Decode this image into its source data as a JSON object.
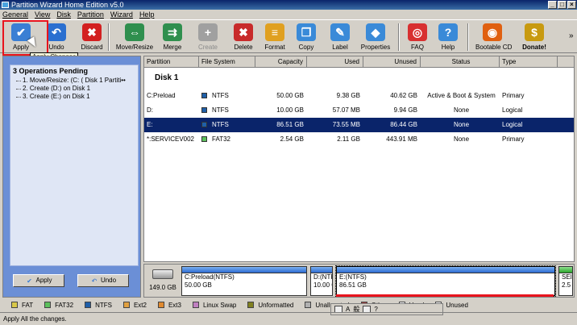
{
  "window": {
    "title": "Partition Wizard Home Edition v5.0"
  },
  "menu": [
    "General",
    "View",
    "Disk",
    "Partition",
    "Wizard",
    "Help"
  ],
  "toolbar": [
    {
      "label": "Apply",
      "icon": "checkmark-icon",
      "color": "#3a7fd4",
      "disabled": false
    },
    {
      "label": "Undo",
      "icon": "undo-arrow-icon",
      "color": "#2a6fd0",
      "disabled": false
    },
    {
      "label": "Discard",
      "icon": "red-x-icon",
      "color": "#d32020",
      "disabled": false
    },
    {
      "label": "Move/Resize",
      "icon": "move-resize-icon",
      "color": "#2f8f4e",
      "disabled": false
    },
    {
      "label": "Merge",
      "icon": "merge-icon",
      "color": "#2f8f4e",
      "disabled": false
    },
    {
      "label": "Create",
      "icon": "create-plus-icon",
      "color": "#a0a0a0",
      "disabled": true
    },
    {
      "label": "Delete",
      "icon": "delete-icon",
      "color": "#c82a2a",
      "disabled": false
    },
    {
      "label": "Format",
      "icon": "format-icon",
      "color": "#e0a020",
      "disabled": false
    },
    {
      "label": "Copy",
      "icon": "copy-icon",
      "color": "#3a8ad8",
      "disabled": false
    },
    {
      "label": "Label",
      "icon": "label-icon",
      "color": "#3a8ad8",
      "disabled": false
    },
    {
      "label": "Properties",
      "icon": "properties-icon",
      "color": "#3a8ad8",
      "disabled": false
    },
    {
      "label": "FAQ",
      "icon": "lifebuoy-icon",
      "color": "#d83030",
      "disabled": false
    },
    {
      "label": "Help",
      "icon": "help-icon",
      "color": "#3a8ad8",
      "disabled": false
    },
    {
      "label": "Bootable CD",
      "icon": "bootable-cd-icon",
      "color": "#e06010",
      "disabled": false
    },
    {
      "label": "Donate!",
      "icon": "dollar-icon",
      "color": "#c89a10",
      "disabled": false
    }
  ],
  "tooltip": "Apply Changes",
  "pending": {
    "title": "3 Operations Pending",
    "items": [
      "1. Move/Resize: (C: ( Disk 1 Partiti••",
      "2. Create (D:) on Disk 1",
      "3. Create (E:) on Disk 1"
    ]
  },
  "left_buttons": {
    "apply": "Apply",
    "undo": "Undo"
  },
  "table": {
    "headers": [
      "Partition",
      "File System",
      "Capacity",
      "Used",
      "Unused",
      "Status",
      "Type"
    ],
    "disk_label": "Disk 1",
    "rows": [
      {
        "partition": "C:Preload",
        "fs": "NTFS",
        "fs_color": "#1f5fa8",
        "capacity": "50.00 GB",
        "used": "9.38 GB",
        "unused": "40.62 GB",
        "status": "Active & Boot & System",
        "type": "Primary"
      },
      {
        "partition": "D:",
        "fs": "NTFS",
        "fs_color": "#1f5fa8",
        "capacity": "10.00 GB",
        "used": "57.07 MB",
        "unused": "9.94 GB",
        "status": "None",
        "type": "Logical"
      },
      {
        "partition": "E:",
        "fs": "NTFS",
        "fs_color": "#1f5fa8",
        "capacity": "86.51 GB",
        "used": "73.55 MB",
        "unused": "86.44 GB",
        "status": "None",
        "type": "Logical"
      },
      {
        "partition": "*:SERVICEV002",
        "fs": "FAT32",
        "fs_color": "#5cc05c",
        "capacity": "2.54 GB",
        "used": "2.11 GB",
        "unused": "443.91 MB",
        "status": "None",
        "type": "Primary"
      }
    ]
  },
  "disk_map": {
    "disk_size": "149.0 GB",
    "segments": [
      {
        "line1": "C:Preload(NTFS)",
        "line2": "50.00 GB"
      },
      {
        "line1": "D:(NTFS",
        "line2": "10.00 G"
      },
      {
        "line1": "E:(NTFS)",
        "line2": "86.51 GB"
      },
      {
        "line1": "SEI",
        "line2": "2.5"
      }
    ]
  },
  "legend": [
    {
      "label": "FAT",
      "color": "#d8c84a"
    },
    {
      "label": "FAT32",
      "color": "#5cc05c"
    },
    {
      "label": "NTFS",
      "color": "#1f5fa8"
    },
    {
      "label": "Ext2",
      "color": "#e0a040"
    },
    {
      "label": "Ext3",
      "color": "#e08a30"
    },
    {
      "label": "Linux Swap",
      "color": "#c080c0"
    },
    {
      "label": "Unformatted",
      "color": "#808020"
    },
    {
      "label": "Unallocated",
      "color": "#b0b0b0"
    },
    {
      "label": "Other",
      "color": "#a04040"
    },
    {
      "label": "Used",
      "color": "#ffffff"
    },
    {
      "label": "Unused",
      "color": "#ffffff"
    }
  ],
  "status_text": "Apply All the changes."
}
